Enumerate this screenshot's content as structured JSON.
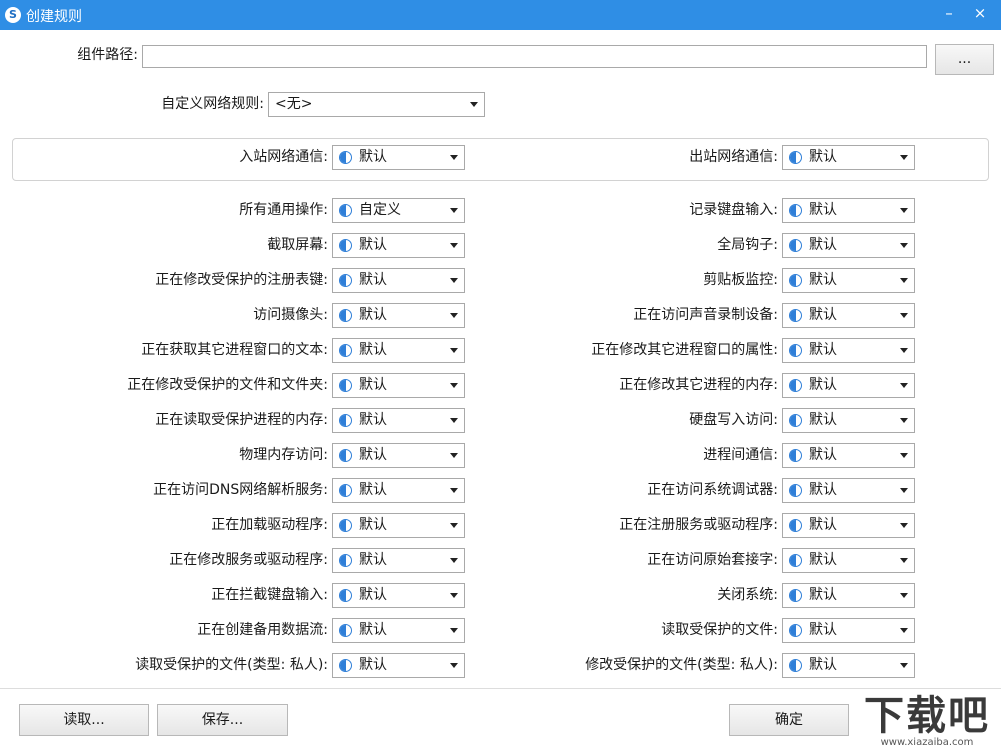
{
  "window": {
    "title": "创建规则",
    "app_icon_letter": "S",
    "min_glyph": "–",
    "close_glyph": "×"
  },
  "path": {
    "label": "组件路径:",
    "value": "",
    "browse_label": "..."
  },
  "network_rule": {
    "label": "自定义网络规则:",
    "value": "<无>"
  },
  "network": {
    "inbound": {
      "label": "入站网络通信:",
      "value": "默认"
    },
    "outbound": {
      "label": "出站网络通信:",
      "value": "默认"
    }
  },
  "rules_left": [
    {
      "label": "所有通用操作:",
      "value": "自定义"
    },
    {
      "label": "截取屏幕:",
      "value": "默认"
    },
    {
      "label": "正在修改受保护的注册表键:",
      "value": "默认"
    },
    {
      "label": "访问摄像头:",
      "value": "默认"
    },
    {
      "label": "正在获取其它进程窗口的文本:",
      "value": "默认"
    },
    {
      "label": "正在修改受保护的文件和文件夹:",
      "value": "默认"
    },
    {
      "label": "正在读取受保护进程的内存:",
      "value": "默认"
    },
    {
      "label": "物理内存访问:",
      "value": "默认"
    },
    {
      "label": "正在访问DNS网络解析服务:",
      "value": "默认"
    },
    {
      "label": "正在加载驱动程序:",
      "value": "默认"
    },
    {
      "label": "正在修改服务或驱动程序:",
      "value": "默认"
    },
    {
      "label": "正在拦截键盘输入:",
      "value": "默认"
    },
    {
      "label": "正在创建备用数据流:",
      "value": "默认"
    },
    {
      "label": "读取受保护的文件(类型: 私人):",
      "value": "默认"
    }
  ],
  "rules_right": [
    {
      "label": "记录键盘输入:",
      "value": "默认"
    },
    {
      "label": "全局钩子:",
      "value": "默认"
    },
    {
      "label": "剪贴板监控:",
      "value": "默认"
    },
    {
      "label": "正在访问声音录制设备:",
      "value": "默认"
    },
    {
      "label": "正在修改其它进程窗口的属性:",
      "value": "默认"
    },
    {
      "label": "正在修改其它进程的内存:",
      "value": "默认"
    },
    {
      "label": "硬盘写入访问:",
      "value": "默认"
    },
    {
      "label": "进程间通信:",
      "value": "默认"
    },
    {
      "label": "正在访问系统调试器:",
      "value": "默认"
    },
    {
      "label": "正在注册服务或驱动程序:",
      "value": "默认"
    },
    {
      "label": "正在访问原始套接字:",
      "value": "默认"
    },
    {
      "label": "关闭系统:",
      "value": "默认"
    },
    {
      "label": "读取受保护的文件:",
      "value": "默认"
    },
    {
      "label": "修改受保护的文件(类型: 私人):",
      "value": "默认"
    }
  ],
  "footer": {
    "load_label": "读取...",
    "save_label": "保存...",
    "ok_label": "确定"
  },
  "watermark": {
    "main": "下载吧",
    "sub": "www.xiazaiba.com"
  },
  "colors": {
    "titlebar": "#2f8ee5",
    "icon_blue": "#2f7fd8"
  }
}
